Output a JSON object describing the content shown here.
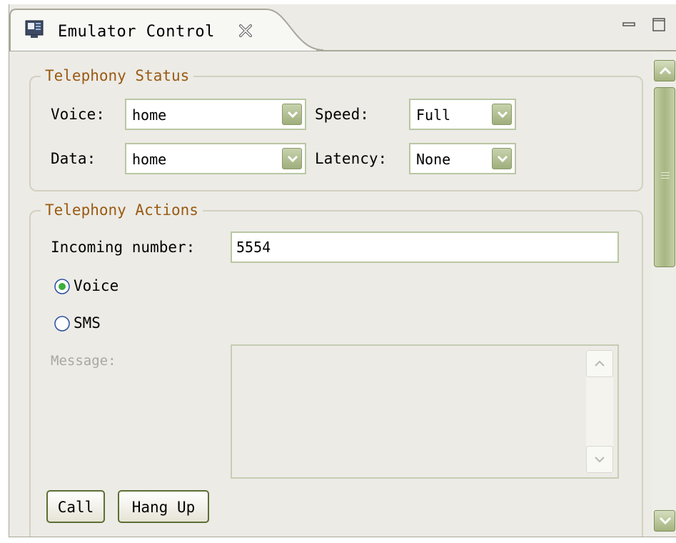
{
  "tab": {
    "title": "Emulator Control",
    "icon": "emulator-control-icon"
  },
  "telephony_status": {
    "title": "Telephony Status",
    "voice_label": "Voice:",
    "voice_value": "home",
    "speed_label": "Speed:",
    "speed_value": "Full",
    "data_label": "Data:",
    "data_value": "home",
    "latency_label": "Latency:",
    "latency_value": "None"
  },
  "telephony_actions": {
    "title": "Telephony Actions",
    "incoming_label": "Incoming number:",
    "incoming_value": "5554",
    "radio_voice_label": "Voice",
    "radio_voice_checked": true,
    "radio_sms_label": "SMS",
    "radio_sms_checked": false,
    "message_label": "Message:",
    "message_value": "",
    "call_button": "Call",
    "hangup_button": "Hang Up"
  },
  "colors": {
    "panel_bg": "#ecebe6",
    "group_title": "#9a5a12",
    "accent_green": "#a3b37d"
  }
}
